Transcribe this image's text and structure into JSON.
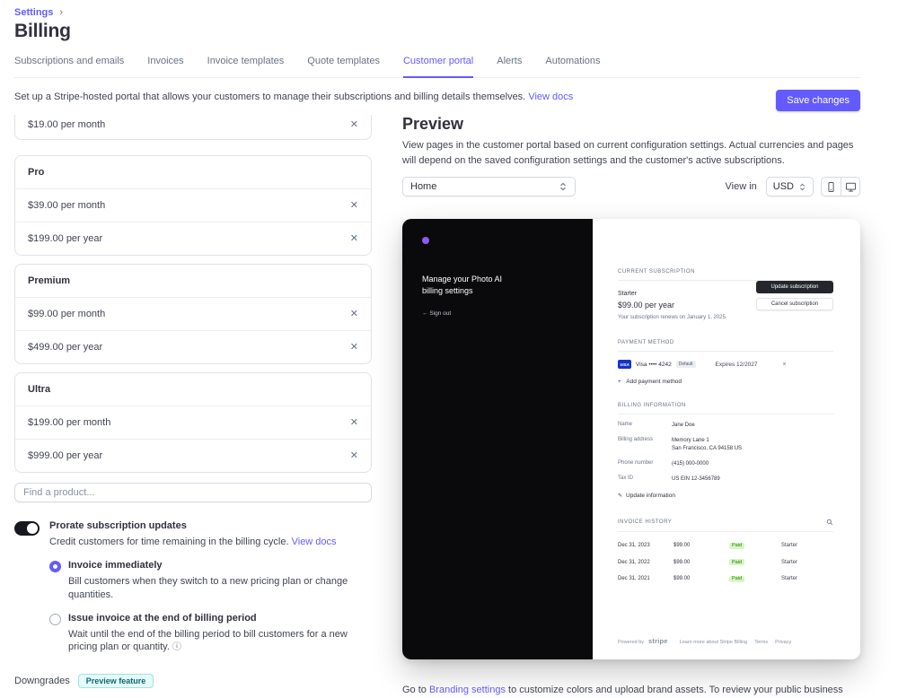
{
  "colors": {
    "accent": "#635bff",
    "paid_badge_bg": "#d7f7c2",
    "portal_sidebar_bg": "#0a0a0c"
  },
  "icons": {
    "breadcrumb_chevron": "›",
    "remove_price": "✕",
    "info": "ⓘ",
    "plus": "+",
    "card_remove": "×",
    "pencil": "✎",
    "signout_arrow": "←"
  },
  "breadcrumb": {
    "settings": "Settings"
  },
  "page": {
    "title": "Billing"
  },
  "tabs": [
    {
      "label": "Subscriptions and emails"
    },
    {
      "label": "Invoices"
    },
    {
      "label": "Invoice templates"
    },
    {
      "label": "Quote templates"
    },
    {
      "label": "Customer portal"
    },
    {
      "label": "Alerts"
    },
    {
      "label": "Automations"
    }
  ],
  "intro": {
    "text": "Set up a Stripe-hosted portal that allows your customers to manage their subscriptions and billing details themselves.",
    "link": "View docs",
    "save_button": "Save changes"
  },
  "products": {
    "orphan_price": "$19.00 per month",
    "groups": [
      {
        "name": "Pro",
        "prices": [
          "$39.00 per month",
          "$199.00 per year"
        ]
      },
      {
        "name": "Premium",
        "prices": [
          "$99.00 per month",
          "$499.00 per year"
        ]
      },
      {
        "name": "Ultra",
        "prices": [
          "$199.00 per month",
          "$999.00 per year"
        ]
      }
    ],
    "search_placeholder": "Find a product..."
  },
  "prorate": {
    "title": "Prorate subscription updates",
    "description": "Credit customers for time remaining in the billing cycle.",
    "link": "View docs",
    "options": [
      {
        "label": "Invoice immediately",
        "description": "Bill customers when they switch to a new pricing plan or change quantities."
      },
      {
        "label": "Issue invoice at the end of billing period",
        "description": "Wait until the end of the billing period to bill customers for a new pricing plan or quantity."
      }
    ]
  },
  "downgrades": {
    "title": "Downgrades",
    "badge": "Preview feature"
  },
  "preview": {
    "title": "Preview",
    "description": "View pages in the customer portal based on current configuration settings. Actual currencies and pages will depend on the saved configuration settings and the customer's active subscriptions.",
    "page_select_value": "Home",
    "view_in_label": "View in",
    "currency_value": "USD",
    "branding_note": {
      "prefix": "Go to ",
      "link": "Branding settings",
      "suffix": " to customize colors and upload brand assets. To review your public business"
    },
    "portal": {
      "sidebar": {
        "heading": "Manage your Photo AI billing settings",
        "signout": "Sign out"
      },
      "subscription": {
        "section": "CURRENT SUBSCRIPTION",
        "plan": "Starter",
        "price": "$99.00 per year",
        "renewal": "Your subscription renews on January 1, 2025.",
        "update_button": "Update subscription",
        "cancel_button": "Cancel subscription"
      },
      "payment": {
        "section": "PAYMENT METHOD",
        "brand": "VISA",
        "card": "Visa •••• 4242",
        "default_badge": "Default",
        "expires": "Expires 12/2027",
        "add_label": "Add payment method"
      },
      "billing_info": {
        "section": "BILLING INFORMATION",
        "name_label": "Name",
        "name_value": "Jane Doe",
        "address_label": "Billing address",
        "address_line1": "Memory Lane 1",
        "address_line2": "San Francisco, CA 94158 US",
        "phone_label": "Phone number",
        "phone_value": "(415) 000-0000",
        "tax_label": "Tax ID",
        "tax_value": "US EIN 12-3456789",
        "update_link": "Update information"
      },
      "invoices": {
        "section": "INVOICE HISTORY",
        "rows": [
          {
            "date": "Dec 31, 2023",
            "amount": "$99.00",
            "status": "Paid",
            "plan": "Starter"
          },
          {
            "date": "Dec 31, 2022",
            "amount": "$99.00",
            "status": "Paid",
            "plan": "Starter"
          },
          {
            "date": "Dec 31, 2021",
            "amount": "$99.00",
            "status": "Paid",
            "plan": "Starter"
          }
        ]
      },
      "footer": {
        "powered_by": "Powered by",
        "brand": "stripe",
        "link1": "Learn more about Stripe Billing",
        "link2": "Terms",
        "link3": "Privacy"
      }
    }
  }
}
